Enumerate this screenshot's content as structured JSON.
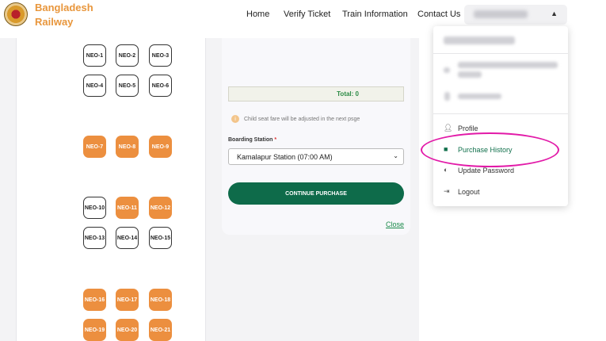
{
  "header": {
    "brand_line1": "Bangladesh",
    "brand_line2": "Railway",
    "nav": [
      "Home",
      "Verify Ticket",
      "Train Information",
      "Contact Us"
    ],
    "user_toggle_icon": "chevron-up-icon"
  },
  "seats": {
    "rows": [
      [
        {
          "label": "NEO-1",
          "status": "available"
        },
        {
          "label": "NEO-2",
          "status": "available"
        },
        {
          "label": "NEO-3",
          "status": "available"
        }
      ],
      [
        {
          "label": "NEO-4",
          "status": "available"
        },
        {
          "label": "NEO-5",
          "status": "available"
        },
        {
          "label": "NEO-6",
          "status": "available"
        }
      ],
      [
        {
          "label": "NEO-7",
          "status": "booked"
        },
        {
          "label": "NEO-8",
          "status": "booked"
        },
        {
          "label": "NEO-9",
          "status": "booked"
        }
      ],
      [
        {
          "label": "NEO-10",
          "status": "available"
        },
        {
          "label": "NEO-11",
          "status": "booked"
        },
        {
          "label": "NEO-12",
          "status": "booked"
        }
      ],
      [
        {
          "label": "NEO-13",
          "status": "available"
        },
        {
          "label": "NEO-14",
          "status": "available"
        },
        {
          "label": "NEO-15",
          "status": "available"
        }
      ],
      [
        {
          "label": "NEO-16",
          "status": "booked"
        },
        {
          "label": "NEO-17",
          "status": "booked"
        },
        {
          "label": "NEO-18",
          "status": "booked"
        }
      ],
      [
        {
          "label": "NEO-19",
          "status": "booked"
        },
        {
          "label": "NEO-20",
          "status": "booked"
        },
        {
          "label": "NEO-21",
          "status": "booked"
        }
      ]
    ]
  },
  "summary": {
    "total_text": "Total: 0",
    "info_text": "Child seat fare will be adjusted in the next psge",
    "boarding_label": "Boarding Station",
    "required_mark": "*",
    "boarding_value": "Kamalapur Station (07:00 AM)",
    "continue_label": "CONTINUE PURCHASE",
    "close_label": "Close"
  },
  "dropdown": {
    "profile_label": "Profile",
    "purchase_history_label": "Purchase History",
    "update_password_label": "Update Password",
    "logout_label": "Logout"
  },
  "colors": {
    "brand": "#e8963c",
    "booked_seat": "#ec8f3f",
    "primary_button": "#0e6b4a",
    "highlight": "#e21aa8"
  }
}
